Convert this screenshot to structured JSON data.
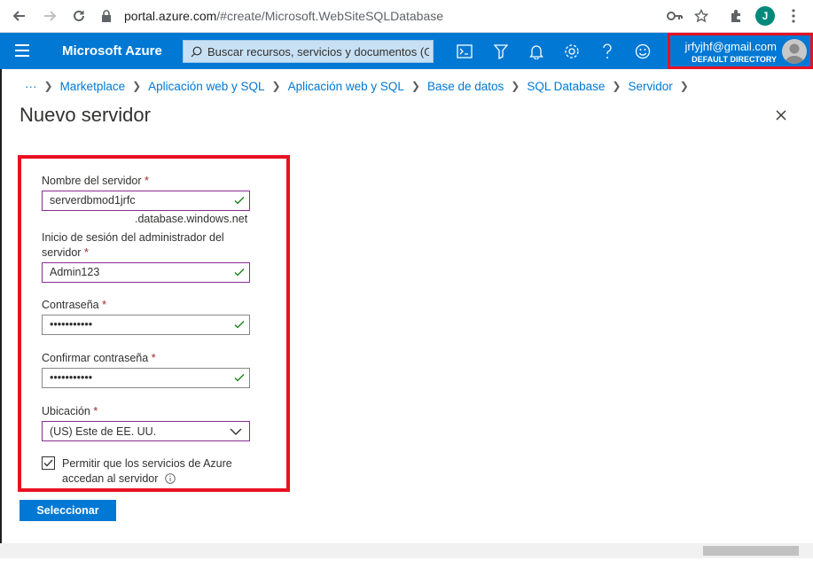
{
  "browser": {
    "url_host": "portal.azure.com",
    "url_path": "/#create/Microsoft.WebSiteSQLDatabase",
    "profile_initial": "J"
  },
  "header": {
    "brand": "Microsoft Azure",
    "search_placeholder": "Buscar recursos, servicios y documentos (G",
    "account_email": "jrfyjhf@gmail.com",
    "account_directory": "DEFAULT DIRECTORY"
  },
  "breadcrumb": {
    "ellipsis": "···",
    "items": [
      "Marketplace",
      "Aplicación web y SQL",
      "Aplicación web y SQL",
      "Base de datos",
      "SQL Database",
      "Servidor"
    ]
  },
  "page": {
    "title": "Nuevo servidor"
  },
  "form": {
    "server_name_label": "Nombre del servidor",
    "server_name_value": "serverdbmod1jrfc",
    "server_suffix": ".database.windows.net",
    "admin_label_line1": "Inicio de sesión del administrador del",
    "admin_label_line2": "servidor",
    "admin_value": "Admin123",
    "password_label": "Contraseña",
    "password_value": "•••••••••••",
    "confirm_label": "Confirmar contraseña",
    "confirm_value": "•••••••••••",
    "location_label": "Ubicación",
    "location_value": "(US) Este de EE. UU.",
    "allow_azure_label_line1": "Permitir que los servicios de Azure",
    "allow_azure_label_line2": "accedan al servidor",
    "allow_azure_checked": true,
    "required_mark": "*"
  },
  "actions": {
    "select_button": "Seleccionar"
  },
  "colors": {
    "azure_blue": "#0078d4",
    "highlight_red": "#e81123",
    "valid_green": "#107c10",
    "field_purple": "#8b2c92"
  }
}
